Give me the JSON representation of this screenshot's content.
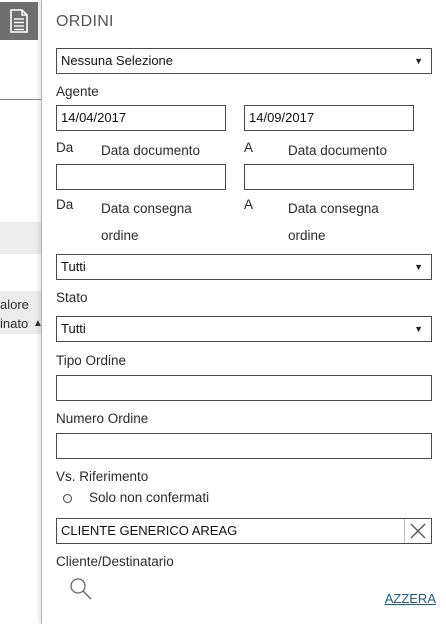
{
  "panel": {
    "title": "ORDINI",
    "selection_dropdown": {
      "value": "Nessuna Selezione"
    },
    "agent_label": "Agente",
    "date_from": {
      "value": "14/04/2017",
      "prefix": "Da",
      "label": "Data documento"
    },
    "date_to": {
      "value": "14/09/2017",
      "prefix": "A",
      "label": "Data documento"
    },
    "delivery_from": {
      "value": "",
      "prefix": "Da",
      "label_line1": "Data consegna",
      "label_line2": "ordine"
    },
    "delivery_to": {
      "value": "",
      "prefix": "A",
      "label_line1": "Data consegna",
      "label_line2": "ordine"
    },
    "status_dropdown": {
      "value": "Tutti"
    },
    "status_label": "Stato",
    "order_type_dropdown": {
      "value": "Tutti"
    },
    "order_type_label": "Tipo Ordine",
    "order_number": {
      "value": ""
    },
    "order_number_label": "Numero Ordine",
    "reference": {
      "value": ""
    },
    "reference_label": "Vs. Riferimento",
    "unconfirmed_option": "Solo non confermati",
    "customer": {
      "value": "CLIENTE GENERICO AREAG"
    },
    "customer_label": "Cliente/Destinatario",
    "reset_label": "AZZERA"
  },
  "background": {
    "column_header_line1": "alore",
    "column_header_line2": "inato"
  },
  "colors": {
    "accent_tile": "#6f6f6f",
    "link": "#1a5c8a",
    "border": "#4a4a4a"
  }
}
